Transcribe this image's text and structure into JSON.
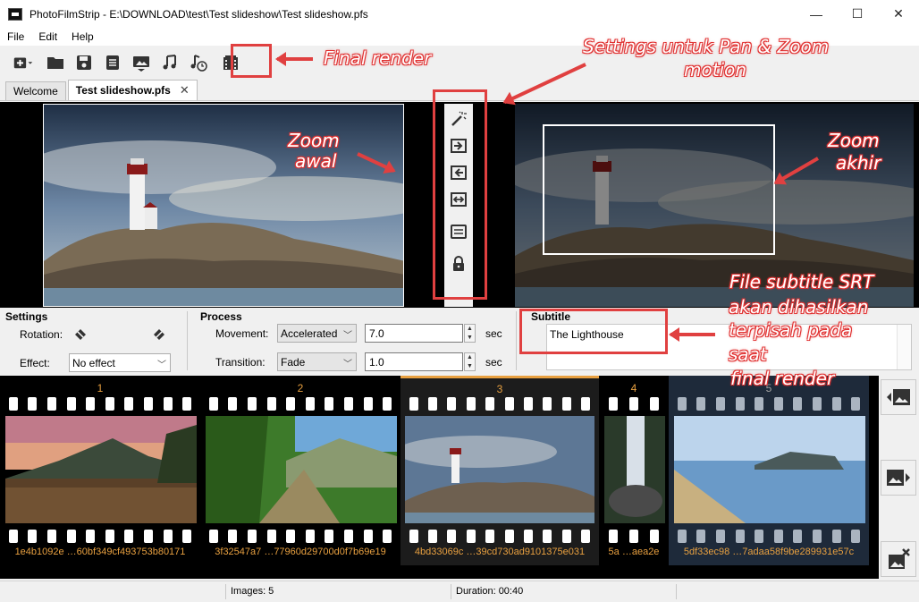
{
  "window": {
    "title": "PhotoFilmStrip - E:\\DOWNLOAD\\test\\Test slideshow\\Test slideshow.pfs",
    "minimize": "—",
    "maximize": "☐",
    "close": "✕"
  },
  "menu": [
    "File",
    "Edit",
    "Help"
  ],
  "tabs": [
    {
      "label": "Welcome",
      "active": false
    },
    {
      "label": "Test slideshow.pfs",
      "active": true,
      "close": "✕"
    }
  ],
  "settings": {
    "title": "Settings",
    "rotation_label": "Rotation:",
    "effect_label": "Effect:",
    "effect_value": "No effect"
  },
  "process": {
    "title": "Process",
    "movement_label": "Movement:",
    "movement_value": "Accelerated",
    "movement_duration": "7.0",
    "transition_label": "Transition:",
    "transition_value": "Fade",
    "transition_duration": "1.0",
    "unit": "sec"
  },
  "subtitle": {
    "title": "Subtitle",
    "text": "The Lighthouse"
  },
  "filmstrip": [
    {
      "num": "1",
      "name": "1e4b1092e …60bf349cf493753b80171"
    },
    {
      "num": "2",
      "name": "3f32547a7 …77960d29700d0f7b69e19"
    },
    {
      "num": "3",
      "name": "4bd33069c …39cd730ad9101375e031"
    },
    {
      "num": "4",
      "name": "5a …aea2e"
    },
    {
      "num": "5",
      "name": "5df33ec98 …7adaa58f9be289931e57c"
    }
  ],
  "status": {
    "images": "Images: 5",
    "duration": "Duration: 00:40"
  },
  "annotations": {
    "final_render": "Final render",
    "settings_pan": "Settings untuk Pan & Zoom",
    "motion": "motion",
    "zoom_awal_1": "Zoom",
    "zoom_awal_2": "awal",
    "zoom_akhir_1": "Zoom",
    "zoom_akhir_2": "akhir",
    "srt_1": "File subtitle SRT",
    "srt_2": "akan dihasilkan",
    "srt_3": "terpisah pada",
    "srt_4": "saat",
    "srt_5": "final render"
  },
  "colors": {
    "accent_orange": "#e8a040",
    "annotation_red": "#e04040"
  }
}
